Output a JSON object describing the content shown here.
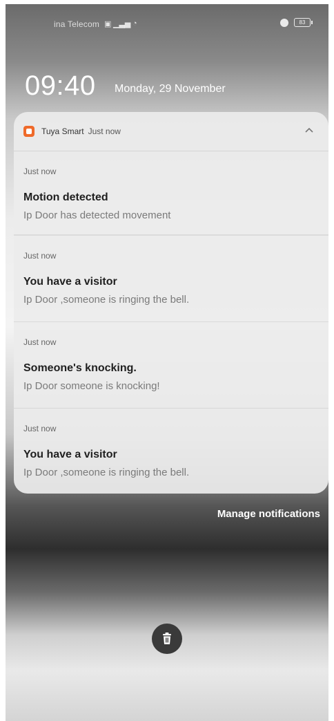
{
  "status_bar": {
    "carrier": "ina Telecom",
    "battery": "83"
  },
  "lockscreen": {
    "time": "09:40",
    "date": "Monday, 29 November"
  },
  "notification_group": {
    "app_name": "Tuya Smart",
    "group_time": "Just now",
    "items": [
      {
        "time": "Just now",
        "title": "Motion detected",
        "body": "Ip Door has detected movement"
      },
      {
        "time": "Just now",
        "title": "You have a visitor",
        "body": "Ip Door ,someone is ringing the bell."
      },
      {
        "time": "Just now",
        "title": "Someone's knocking.",
        "body": "Ip Door someone is knocking!"
      },
      {
        "time": "Just now",
        "title": "You have a visitor",
        "body": "Ip Door ,someone is ringing the bell."
      }
    ]
  },
  "manage_label": "Manage notifications",
  "icons": {
    "app": "tuya-app-icon",
    "collapse": "chevron-up-icon",
    "clear": "trash-icon"
  },
  "colors": {
    "accent_app": "#ef6a2a"
  }
}
